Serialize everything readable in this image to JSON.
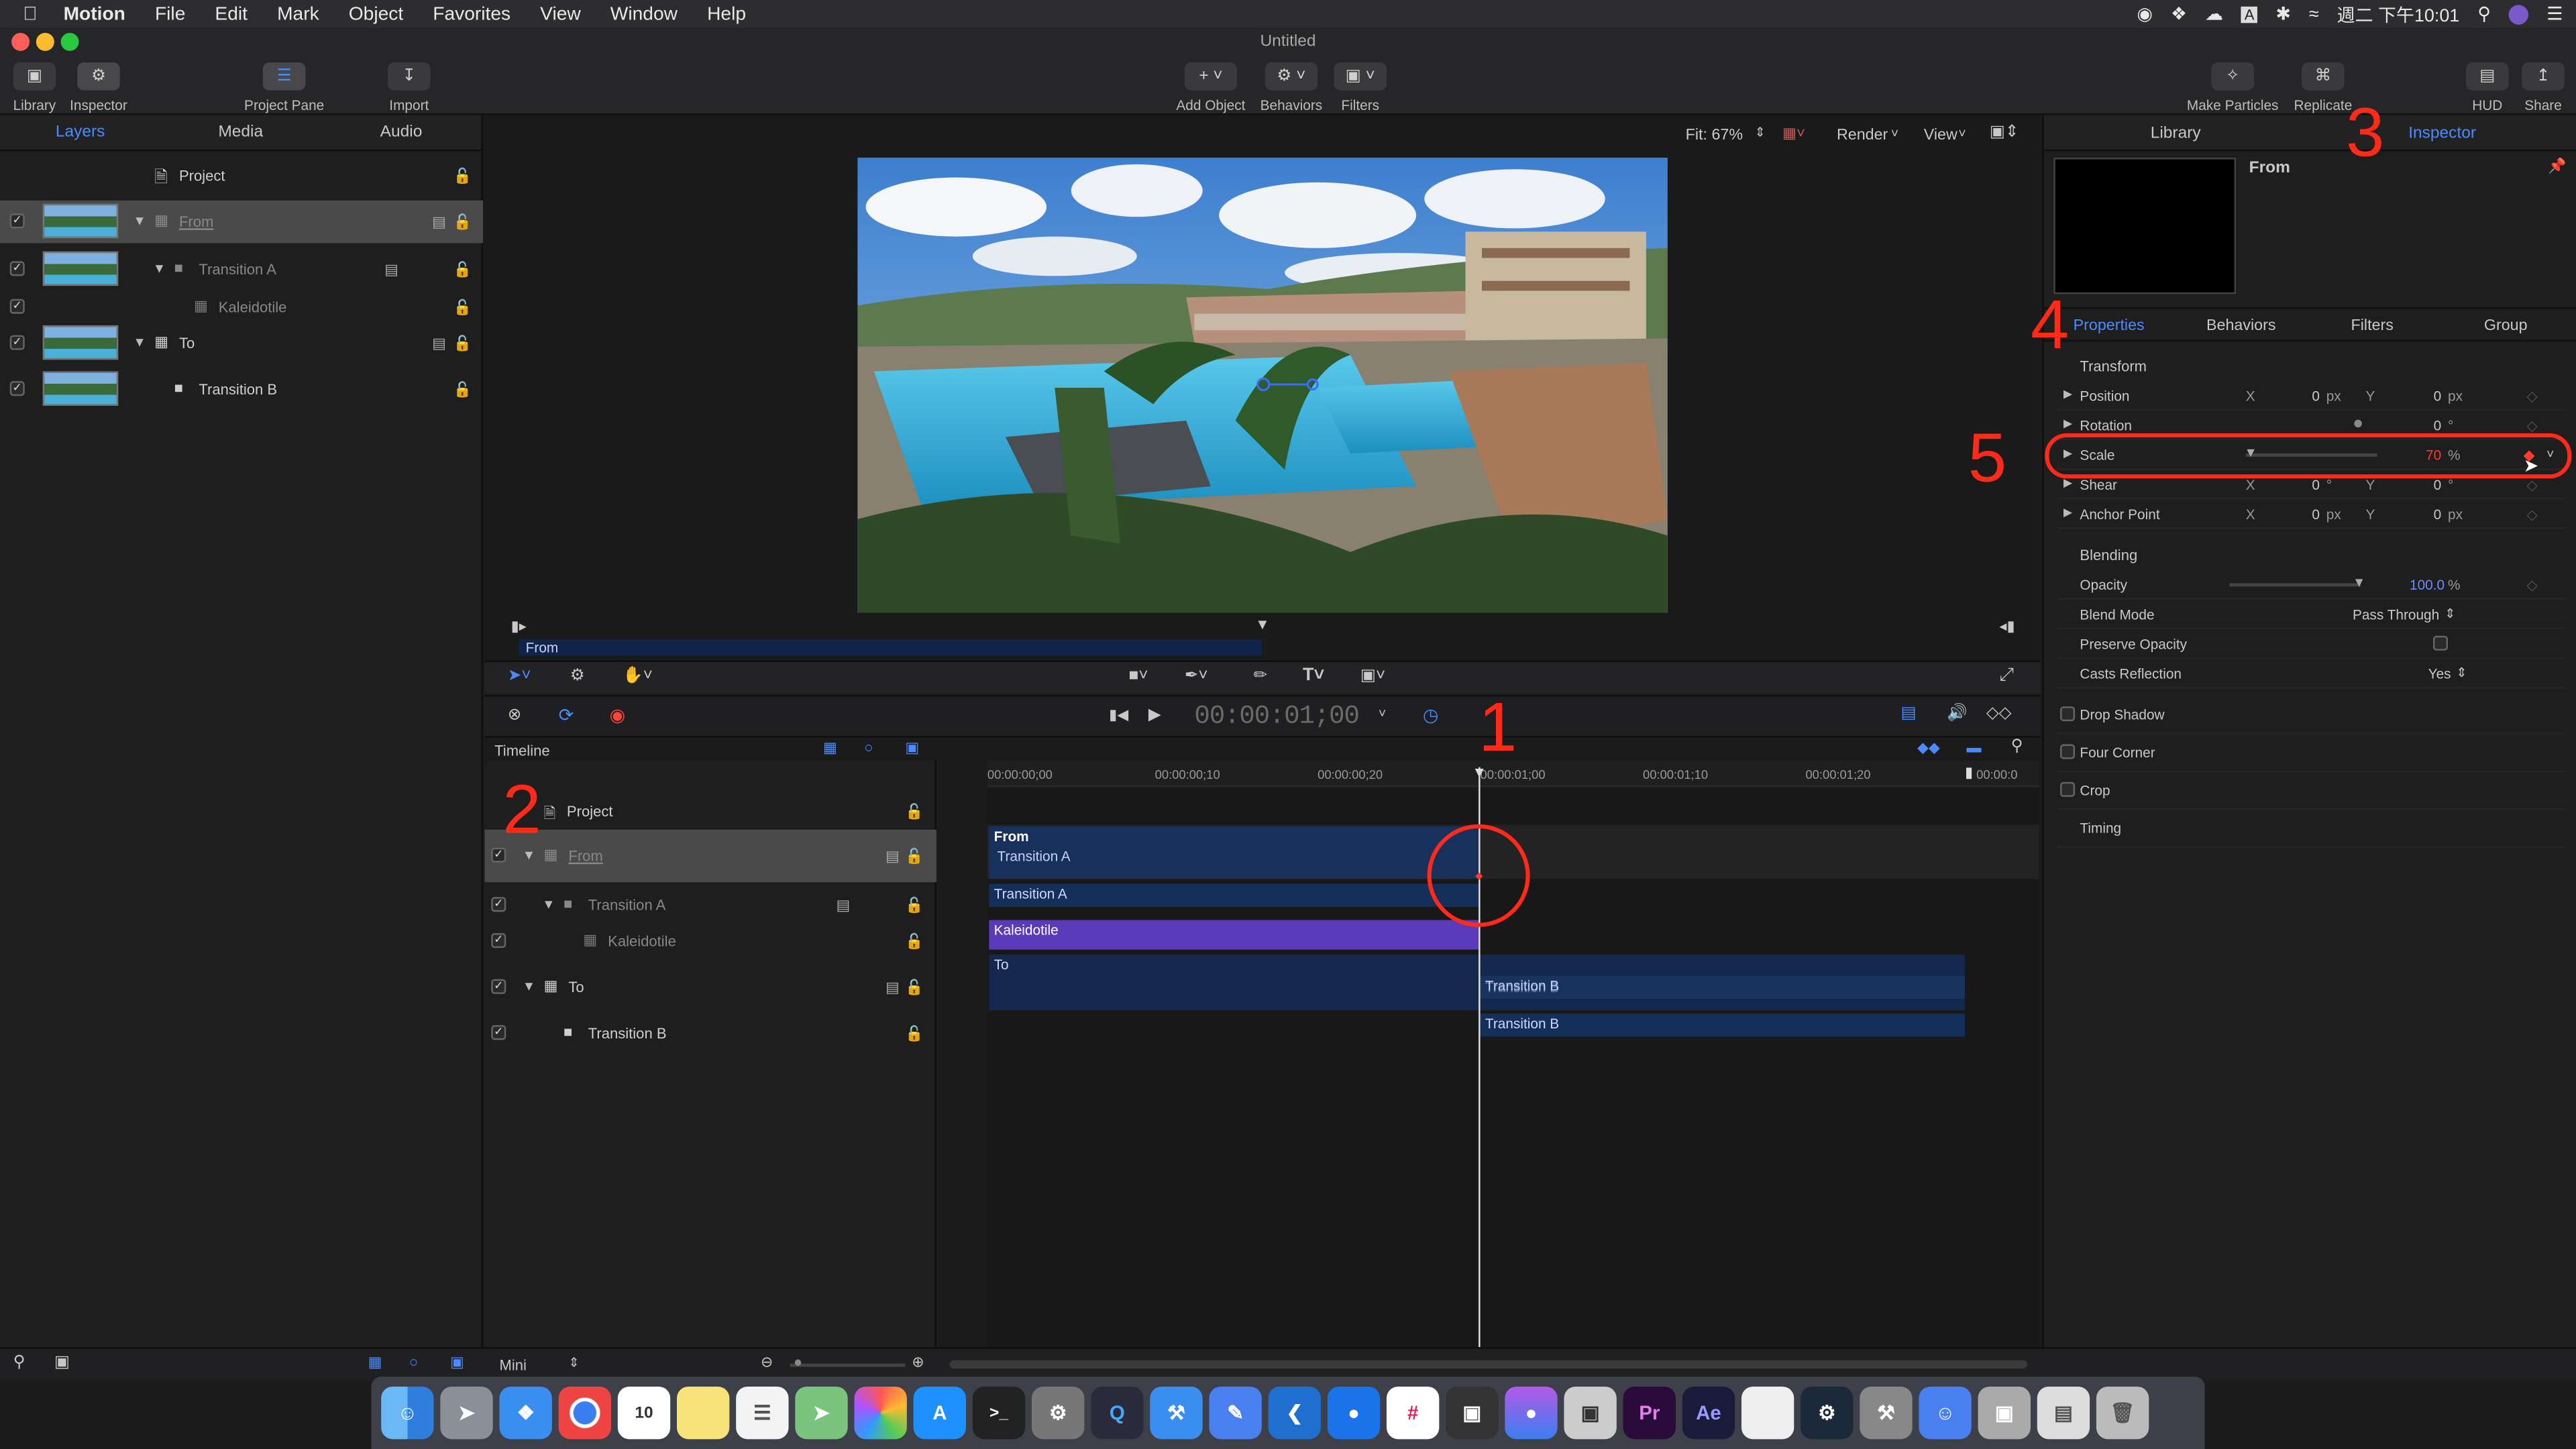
{
  "menubar": {
    "app": "Motion",
    "items": [
      "File",
      "Edit",
      "Mark",
      "Object",
      "Favorites",
      "View",
      "Window",
      "Help"
    ],
    "clock": "週二 下午10:01"
  },
  "window": {
    "title": "Untitled"
  },
  "toolbar": {
    "library": "Library",
    "inspector": "Inspector",
    "project_pane": "Project Pane",
    "import": "Import",
    "add_object": "Add Object",
    "behaviors": "Behaviors",
    "filters": "Filters",
    "make_particles": "Make Particles",
    "replicate": "Replicate",
    "hud": "HUD",
    "share": "Share"
  },
  "left_tabs": [
    "Layers",
    "Media",
    "Audio"
  ],
  "layers": [
    {
      "name": "Project",
      "checked": false
    },
    {
      "name": "From",
      "checked": true
    },
    {
      "name": "Transition A",
      "checked": true
    },
    {
      "name": "Kaleidotile",
      "checked": true
    },
    {
      "name": "To",
      "checked": true
    },
    {
      "name": "Transition B",
      "checked": true
    }
  ],
  "viewer": {
    "fit": "Fit: 67%",
    "render": "Render",
    "view": "View",
    "mini_label": "From"
  },
  "transport": {
    "timecode": "00:00:01;00"
  },
  "timeline": {
    "title": "Timeline",
    "ruler": [
      "00:00:00;00",
      "00:00:00;10",
      "00:00:00;20",
      "00:00:01;00",
      "00:00:01;10",
      "00:00:01;20",
      "00:00:0"
    ],
    "layers": [
      {
        "name": "Project",
        "checked": false
      },
      {
        "name": "From",
        "checked": true
      },
      {
        "name": "Transition A",
        "checked": true
      },
      {
        "name": "Kaleidotile",
        "checked": true
      },
      {
        "name": "To",
        "checked": true
      },
      {
        "name": "Transition B",
        "checked": true
      }
    ],
    "bars": {
      "from": "From",
      "transition_a_sub": "Transition A",
      "transition_a": "Transition A",
      "kaleidotile": "Kaleidotile",
      "to": "To",
      "transition_b_sub": "Transition B",
      "transition_b": "Transition B"
    },
    "zoom_label": "Mini"
  },
  "inspector": {
    "tabs": [
      "Library",
      "Inspector"
    ],
    "object_name": "From",
    "subtabs": [
      "Properties",
      "Behaviors",
      "Filters",
      "Group"
    ],
    "transform_header": "Transform",
    "position": {
      "label": "Position",
      "x": "0",
      "y": "0",
      "unit": "px"
    },
    "rotation": {
      "label": "Rotation",
      "value": "0",
      "unit": "°"
    },
    "scale": {
      "label": "Scale",
      "value": "70",
      "unit": "%"
    },
    "shear": {
      "label": "Shear",
      "x": "0",
      "y": "0",
      "unit": "°"
    },
    "anchor": {
      "label": "Anchor Point",
      "x": "0",
      "y": "0",
      "unit": "px"
    },
    "blending_header": "Blending",
    "opacity": {
      "label": "Opacity",
      "value": "100.0",
      "unit": "%"
    },
    "blend_mode": {
      "label": "Blend Mode",
      "value": "Pass Through"
    },
    "preserve_opacity": {
      "label": "Preserve Opacity"
    },
    "casts_reflection": {
      "label": "Casts Reflection",
      "value": "Yes"
    },
    "drop_shadow": "Drop Shadow",
    "four_corner": "Four Corner",
    "crop": "Crop",
    "timing": "Timing",
    "x_label": "X",
    "y_label": "Y"
  },
  "annotations": [
    "1",
    "2",
    "3",
    "4",
    "5"
  ],
  "colors": {
    "accent": "#4a8cff",
    "annotation": "#ff2a1a",
    "keyframe": "#ff3b30"
  }
}
